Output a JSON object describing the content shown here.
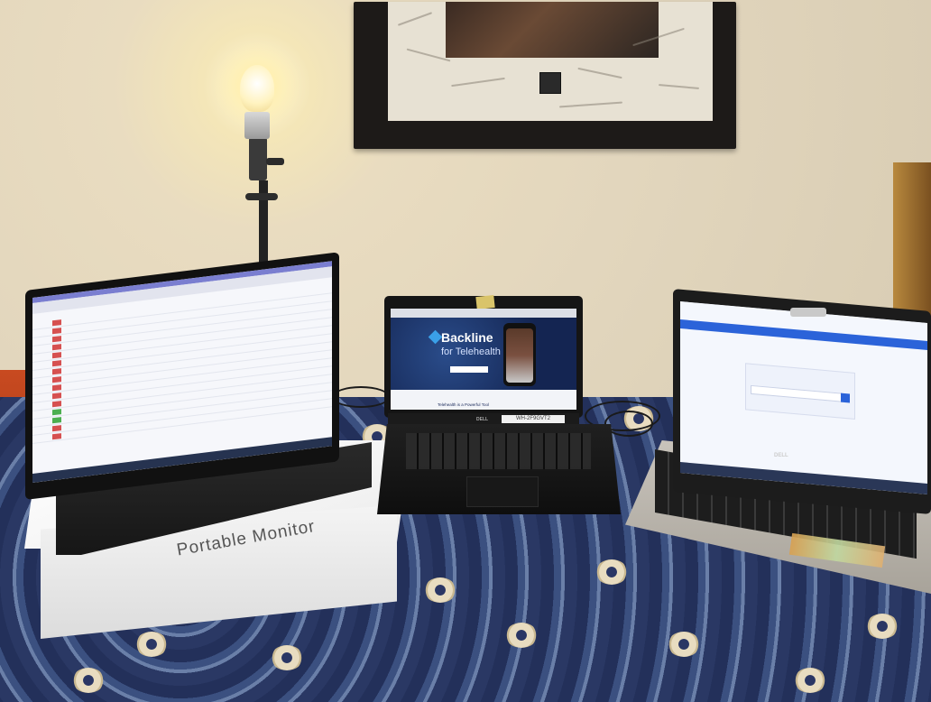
{
  "scene": {
    "box_label": "Portable Monitor",
    "middle_laptop": {
      "brand_label": "DELL",
      "asset_tag": "WH-2F9GVT2",
      "screen": {
        "app_name": "Backline",
        "tagline": "for Telehealth",
        "footer_text": "Telehealth is a Powerful Tool"
      }
    },
    "right_laptop": {
      "brand_label": "DELL"
    }
  }
}
